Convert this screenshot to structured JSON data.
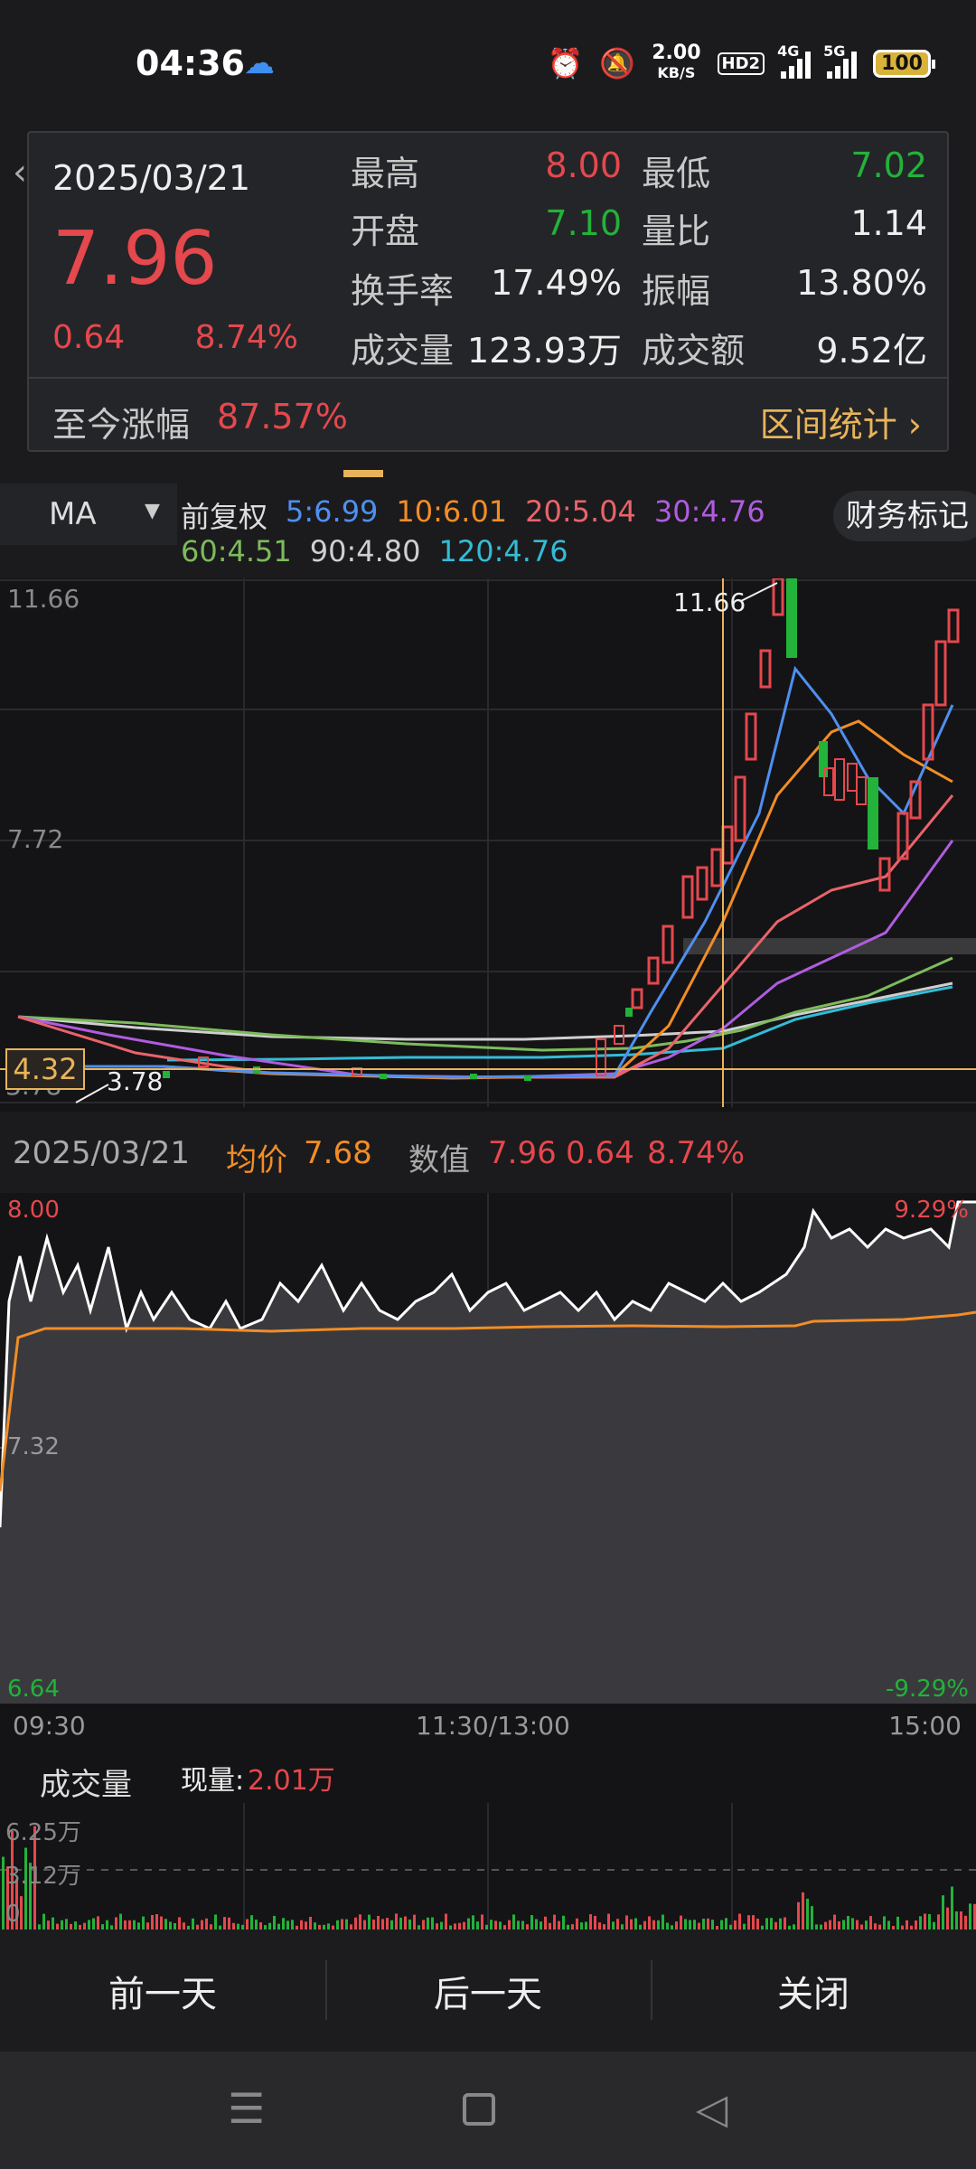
{
  "status_bar": {
    "time": "04:36",
    "speed_value": "2.00",
    "speed_unit": "KB/S",
    "hd": "HD2",
    "net1": "4G",
    "net2": "5G",
    "battery": "100",
    "icons": [
      "cloud-icon",
      "alarm-icon",
      "mute-icon",
      "signal-icon",
      "battery-icon"
    ]
  },
  "info": {
    "date": "2025/03/21",
    "price": "7.96",
    "change": "0.64",
    "change_pct": "8.74%",
    "high_label": "最高",
    "high": "8.00",
    "low_label": "最低",
    "low": "7.02",
    "open_label": "开盘",
    "open": "7.10",
    "vol_ratio_label": "量比",
    "vol_ratio": "1.14",
    "turnover_label": "换手率",
    "turnover": "17.49%",
    "amplitude_label": "振幅",
    "amplitude": "13.80%",
    "volume_label": "成交量",
    "volume": "123.93万",
    "amount_label": "成交额",
    "amount": "9.52亿",
    "since_label": "至今涨幅",
    "since_value": "87.57%",
    "stats_link": "区间统计 ›"
  },
  "ma": {
    "selector": "MA",
    "adjust": "前复权",
    "items_line1": [
      {
        "text": "5:6.99",
        "color": "#4f8ff0"
      },
      {
        "text": "10:6.01",
        "color": "#f28d26"
      },
      {
        "text": "20:5.04",
        "color": "#e9646a"
      },
      {
        "text": "30:4.76",
        "color": "#b05ce0"
      }
    ],
    "items_line2": [
      {
        "text": "60:4.51",
        "color": "#7dbb5c"
      },
      {
        "text": "90:4.80",
        "color": "#cfcfcf"
      },
      {
        "text": "120:4.76",
        "color": "#33bcd6"
      }
    ],
    "financial_mark": "财务标记"
  },
  "kline": {
    "y_top": "11.66",
    "y_mid": "7.72",
    "y_bottom": "3.78",
    "cursor_price": "4.32",
    "high_marker": "11.66",
    "low_marker": "3.78"
  },
  "intraday": {
    "date": "2025/03/21",
    "avg_label": "均价",
    "avg": "7.68",
    "value_label": "数值",
    "value": "7.96",
    "change": "0.64",
    "change_pct": "8.74%",
    "y_top": "8.00",
    "y_top_pct": "9.29%",
    "y_mid": "7.32",
    "y_bottom": "6.64",
    "y_bottom_pct": "-9.29%",
    "t_start": "09:30",
    "t_mid": "11:30/13:00",
    "t_end": "15:00"
  },
  "volume": {
    "label": "成交量",
    "current_label": "现量:",
    "current": "2.01万",
    "y_top": "6.25万",
    "y_mid": "3.12万",
    "y_bottom": "0"
  },
  "buttons": {
    "prev": "前一天",
    "next": "后一天",
    "close": "关闭"
  },
  "colors": {
    "up": "#e5484d",
    "down": "#23b23a",
    "accent": "#e8b45a"
  }
}
